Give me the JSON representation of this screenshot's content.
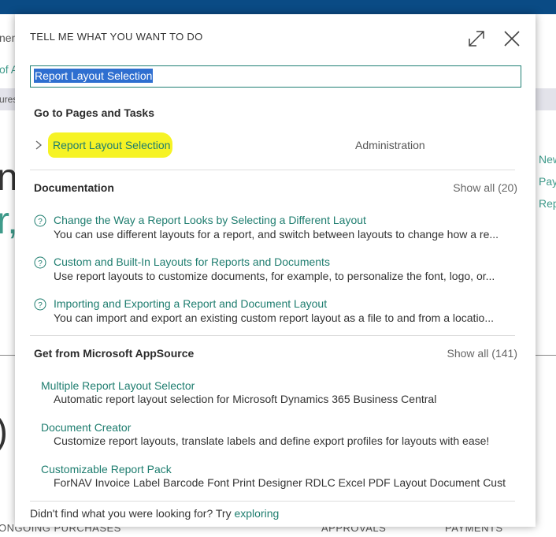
{
  "background": {
    "left_texts": [
      "nen",
      "of A",
      "ures"
    ],
    "big_glyph_1": "n",
    "big_glyph_2": "r,",
    "big_glyph_3": ")",
    "right_links": [
      "New",
      "Pay",
      "Rep"
    ],
    "bottom_tabs": [
      "ONGOING PURCHASES",
      "APPROVALS",
      "PAYMENTS"
    ]
  },
  "dialog": {
    "title": "TELL ME WHAT YOU WANT TO DO",
    "search": {
      "value": "Report Layout Selection"
    },
    "pages": {
      "heading": "Go to Pages and Tasks",
      "items": [
        {
          "label": "Report Layout Selection",
          "category": "Administration"
        }
      ]
    },
    "documentation": {
      "heading": "Documentation",
      "show_all": "Show all (20)",
      "items": [
        {
          "title": "Change the Way a Report Looks by Selecting a Different Layout",
          "desc": "You can use different layouts for a report, and switch between layouts to change how a re..."
        },
        {
          "title": "Custom and Built-In Layouts for Reports and Documents",
          "desc": "Use report layouts to customize documents, for example, to personalize the font, logo, or..."
        },
        {
          "title": "Importing and Exporting a Report and Document Layout",
          "desc": "You can import and export an existing custom report layout as a file to and from a locatio..."
        }
      ]
    },
    "appsource": {
      "heading": "Get from Microsoft AppSource",
      "show_all": "Show all (141)",
      "items": [
        {
          "title": "Multiple Report Layout Selector",
          "desc": "Automatic report layout selection for Microsoft Dynamics 365 Business Central"
        },
        {
          "title": "Document Creator",
          "desc": "Customize report layouts, translate labels and define export profiles for layouts with ease!"
        },
        {
          "title": "Customizable Report Pack",
          "desc": "ForNAV Invoice Label Barcode Font Print Designer RDLC Excel PDF Layout Document Cust..."
        }
      ]
    },
    "footer": {
      "text": "Didn't find what you were looking for? Try ",
      "link": "exploring"
    }
  },
  "colors": {
    "accent": "#1e7d6f",
    "topbar": "#0a4b85",
    "highlight": "#f6f325",
    "selection": "#2f6fd0"
  }
}
